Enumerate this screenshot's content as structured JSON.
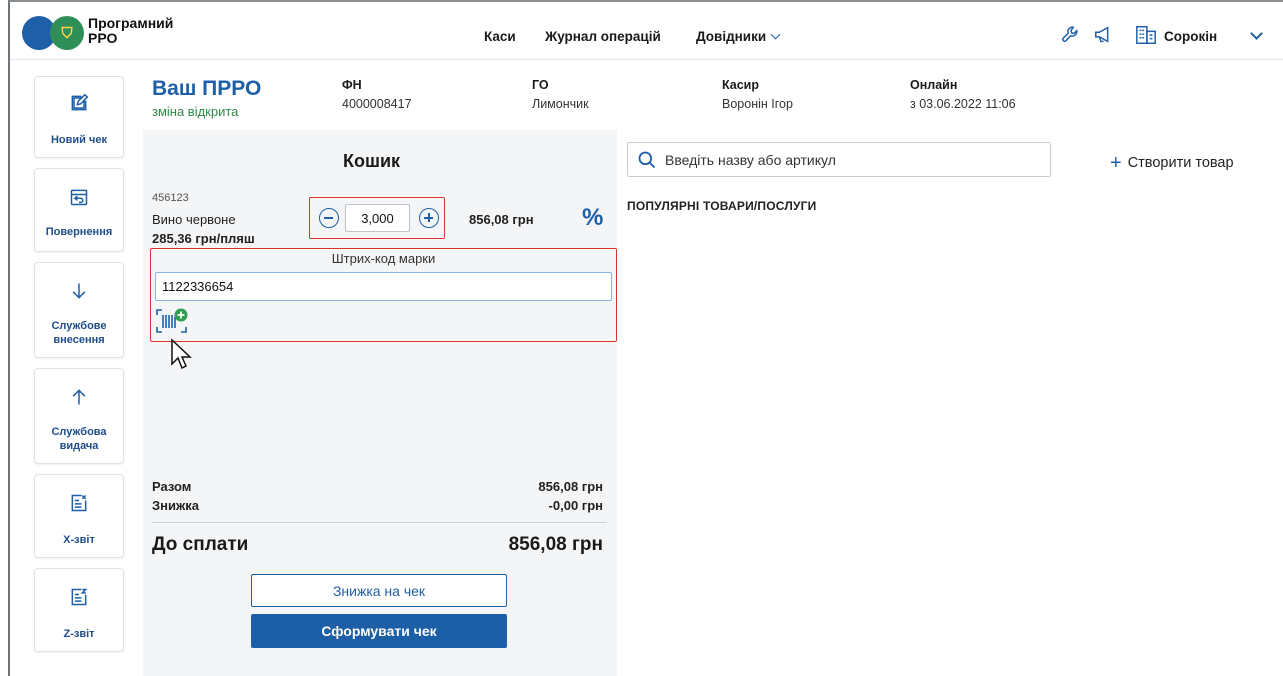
{
  "header": {
    "brand": "Програмний РРО",
    "nav": [
      "Каси",
      "Журнал операцій",
      "Довідники"
    ],
    "user": "Сорокін",
    "icons": [
      "emblem-icon",
      "wrench-icon",
      "megaphone-icon",
      "building-icon",
      "chevron-down-icon"
    ]
  },
  "sidebar": {
    "items": [
      {
        "label": "Новий чек",
        "icon": "edit-icon"
      },
      {
        "label": "Повернення",
        "icon": "return-icon"
      },
      {
        "label": "Службове внесення",
        "icon": "arrow-down-icon"
      },
      {
        "label": "Службова видача",
        "icon": "arrow-up-icon"
      },
      {
        "label": "X-звіт",
        "icon": "x-report-icon"
      },
      {
        "label": "Z-звіт",
        "icon": "z-report-icon"
      }
    ]
  },
  "info": {
    "title": "Ваш ПРРО",
    "status": "зміна відкрита",
    "fn_label": "ФН",
    "fn_value": "4000008417",
    "go_label": "ГО",
    "go_value": "Лимончик",
    "cashier_label": "Касир",
    "cashier_value": "Воронін Ігор",
    "online_label": "Онлайн",
    "online_value": "з 03.06.2022 11:06"
  },
  "cart": {
    "title": "Кошик",
    "item": {
      "code": "456123",
      "name": "Вино червоне",
      "price": "285,36 грн/пляш",
      "quantity": "3,000",
      "sum": "856,08 грн",
      "discount_symbol": "%"
    },
    "barcode": {
      "label": "Штрих-код марки",
      "value": "1122336654"
    },
    "totals": {
      "sum_label": "Разом",
      "sum_value": "856,08 грн",
      "discount_label": "Знижка",
      "discount_value": "-0,00 грн",
      "pay_label": "До сплати",
      "pay_value": "856,08 грн"
    },
    "discount_button": "Знижка на чек",
    "form_button": "Сформувати чек"
  },
  "products": {
    "search_placeholder": "Введіть назву або артикул",
    "create_label": "Створити товар",
    "popular_label": "ПОПУЛЯРНІ ТОВАРИ/ПОСЛУГИ"
  },
  "colors": {
    "accent": "#1f5fa8",
    "status_green": "#2e8b45",
    "highlight_red": "#d9342b"
  }
}
